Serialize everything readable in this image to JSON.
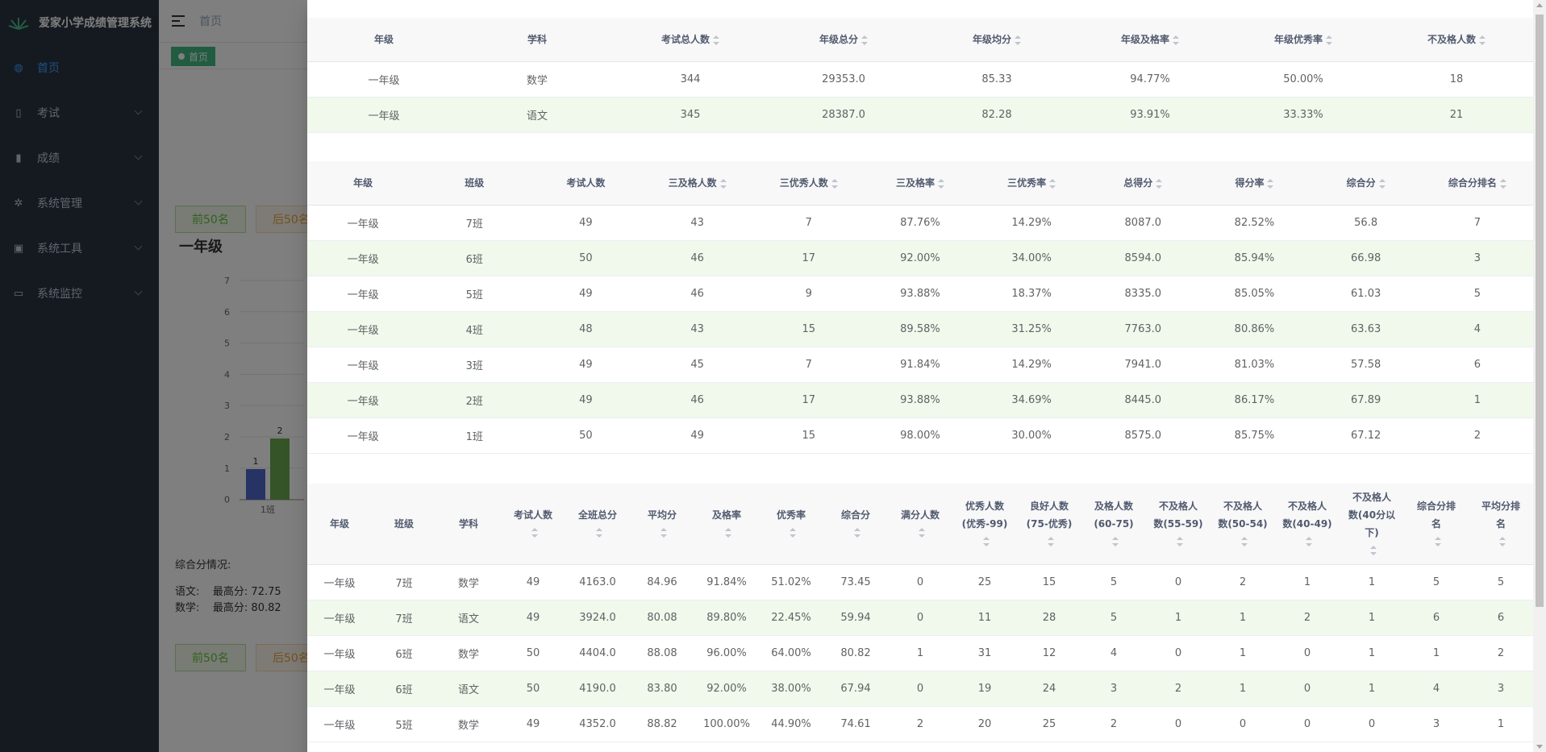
{
  "app": {
    "title": "爱家小学成绩管理系统"
  },
  "sidebar": {
    "items": [
      {
        "label": "首页",
        "icon": "dashboard-icon",
        "active": true
      },
      {
        "label": "考试",
        "icon": "book-icon"
      },
      {
        "label": "成绩",
        "icon": "notebook-icon"
      },
      {
        "label": "系统管理",
        "icon": "gear-icon"
      },
      {
        "label": "系统工具",
        "icon": "toolbox-icon"
      },
      {
        "label": "系统监控",
        "icon": "monitor-icon"
      }
    ]
  },
  "navbar": {
    "breadcrumb": "首页"
  },
  "tags": {
    "home": "首页"
  },
  "background": {
    "top50": "前50名",
    "bottom50": "后50名",
    "grade_title": "一年级",
    "y_ticks": [
      "7",
      "6",
      "5",
      "4",
      "3",
      "2",
      "1",
      "0"
    ],
    "bar_labels": [
      "1",
      "2"
    ],
    "x_label": "1班",
    "summary_title": "综合分情况:",
    "summary_lines": [
      {
        "subject": "语文:",
        "max": "最高分: 72.75"
      },
      {
        "subject": "数学:",
        "max": "最高分: 80.82"
      }
    ]
  },
  "table1": {
    "headers": [
      "年级",
      "学科",
      "考试总人数",
      "年级总分",
      "年级均分",
      "年级及格率",
      "年级优秀率",
      "不及格人数"
    ],
    "sortable": [
      false,
      false,
      true,
      true,
      true,
      true,
      true,
      true
    ],
    "rows": [
      [
        "一年级",
        "数学",
        "344",
        "29353.0",
        "85.33",
        "94.77%",
        "50.00%",
        "18"
      ],
      [
        "一年级",
        "语文",
        "345",
        "28387.0",
        "82.28",
        "93.91%",
        "33.33%",
        "21"
      ]
    ]
  },
  "table2": {
    "headers": [
      "年级",
      "班级",
      "考试人数",
      "三及格人数",
      "三优秀人数",
      "三及格率",
      "三优秀率",
      "总得分",
      "得分率",
      "综合分",
      "综合分排名"
    ],
    "sortable": [
      false,
      false,
      false,
      true,
      true,
      true,
      true,
      true,
      true,
      true,
      true
    ],
    "rows": [
      [
        "一年级",
        "7班",
        "49",
        "43",
        "7",
        "87.76%",
        "14.29%",
        "8087.0",
        "82.52%",
        "56.8",
        "7"
      ],
      [
        "一年级",
        "6班",
        "50",
        "46",
        "17",
        "92.00%",
        "34.00%",
        "8594.0",
        "85.94%",
        "66.98",
        "3"
      ],
      [
        "一年级",
        "5班",
        "49",
        "46",
        "9",
        "93.88%",
        "18.37%",
        "8335.0",
        "85.05%",
        "61.03",
        "5"
      ],
      [
        "一年级",
        "4班",
        "48",
        "43",
        "15",
        "89.58%",
        "31.25%",
        "7763.0",
        "80.86%",
        "63.63",
        "4"
      ],
      [
        "一年级",
        "3班",
        "49",
        "45",
        "7",
        "91.84%",
        "14.29%",
        "7941.0",
        "81.03%",
        "57.58",
        "6"
      ],
      [
        "一年级",
        "2班",
        "49",
        "46",
        "17",
        "93.88%",
        "34.69%",
        "8445.0",
        "86.17%",
        "67.89",
        "1"
      ],
      [
        "一年级",
        "1班",
        "50",
        "49",
        "15",
        "98.00%",
        "30.00%",
        "8575.0",
        "85.75%",
        "67.12",
        "2"
      ]
    ]
  },
  "table3": {
    "headers": [
      {
        "l1": "年级",
        "l2": "",
        "l3": "",
        "sort": false
      },
      {
        "l1": "班级",
        "l2": "",
        "l3": "",
        "sort": false
      },
      {
        "l1": "学科",
        "l2": "",
        "l3": "",
        "sort": false
      },
      {
        "l1": "考试人数",
        "l2": "",
        "l3": "",
        "sort": true
      },
      {
        "l1": "全班总分",
        "l2": "",
        "l3": "",
        "sort": true
      },
      {
        "l1": "平均分",
        "l2": "",
        "l3": "",
        "sort": true
      },
      {
        "l1": "及格率",
        "l2": "",
        "l3": "",
        "sort": true
      },
      {
        "l1": "优秀率",
        "l2": "",
        "l3": "",
        "sort": true
      },
      {
        "l1": "综合分",
        "l2": "",
        "l3": "",
        "sort": true
      },
      {
        "l1": "满分人数",
        "l2": "",
        "l3": "",
        "sort": true
      },
      {
        "l1": "优秀人数",
        "l2": "(优秀-99)",
        "l3": "",
        "sort": true
      },
      {
        "l1": "良好人数",
        "l2": "(75-优秀)",
        "l3": "",
        "sort": true
      },
      {
        "l1": "及格人数",
        "l2": "(60-75)",
        "l3": "",
        "sort": true
      },
      {
        "l1": "不及格人",
        "l2": "数(55-59)",
        "l3": "",
        "sort": true
      },
      {
        "l1": "不及格人",
        "l2": "数(50-54)",
        "l3": "",
        "sort": true
      },
      {
        "l1": "不及格人",
        "l2": "数(40-49)",
        "l3": "",
        "sort": true
      },
      {
        "l1": "不及格人",
        "l2": "数(40分以",
        "l3": "下)",
        "sort": true
      },
      {
        "l1": "综合分排",
        "l2": "名",
        "l3": "",
        "sort": true
      },
      {
        "l1": "平均分排",
        "l2": "名",
        "l3": "",
        "sort": true
      }
    ],
    "rows": [
      [
        "一年级",
        "7班",
        "数学",
        "49",
        "4163.0",
        "84.96",
        "91.84%",
        "51.02%",
        "73.45",
        "0",
        "25",
        "15",
        "5",
        "0",
        "2",
        "1",
        "1",
        "5",
        "5"
      ],
      [
        "一年级",
        "7班",
        "语文",
        "49",
        "3924.0",
        "80.08",
        "89.80%",
        "22.45%",
        "59.94",
        "0",
        "11",
        "28",
        "5",
        "1",
        "1",
        "2",
        "1",
        "6",
        "6"
      ],
      [
        "一年级",
        "6班",
        "数学",
        "50",
        "4404.0",
        "88.08",
        "96.00%",
        "64.00%",
        "80.82",
        "1",
        "31",
        "12",
        "4",
        "0",
        "1",
        "0",
        "1",
        "1",
        "2"
      ],
      [
        "一年级",
        "6班",
        "语文",
        "50",
        "4190.0",
        "83.80",
        "92.00%",
        "38.00%",
        "67.94",
        "0",
        "19",
        "24",
        "3",
        "2",
        "1",
        "0",
        "1",
        "4",
        "3"
      ],
      [
        "一年级",
        "5班",
        "数学",
        "49",
        "4352.0",
        "88.82",
        "100.00%",
        "44.90%",
        "74.61",
        "2",
        "20",
        "25",
        "2",
        "0",
        "0",
        "0",
        "0",
        "3",
        "1"
      ]
    ]
  },
  "colors": {
    "sidebar_bg": "#2b3442",
    "active": "#409eff",
    "stripe": "#f0f9eb",
    "tag": "#42b983"
  }
}
